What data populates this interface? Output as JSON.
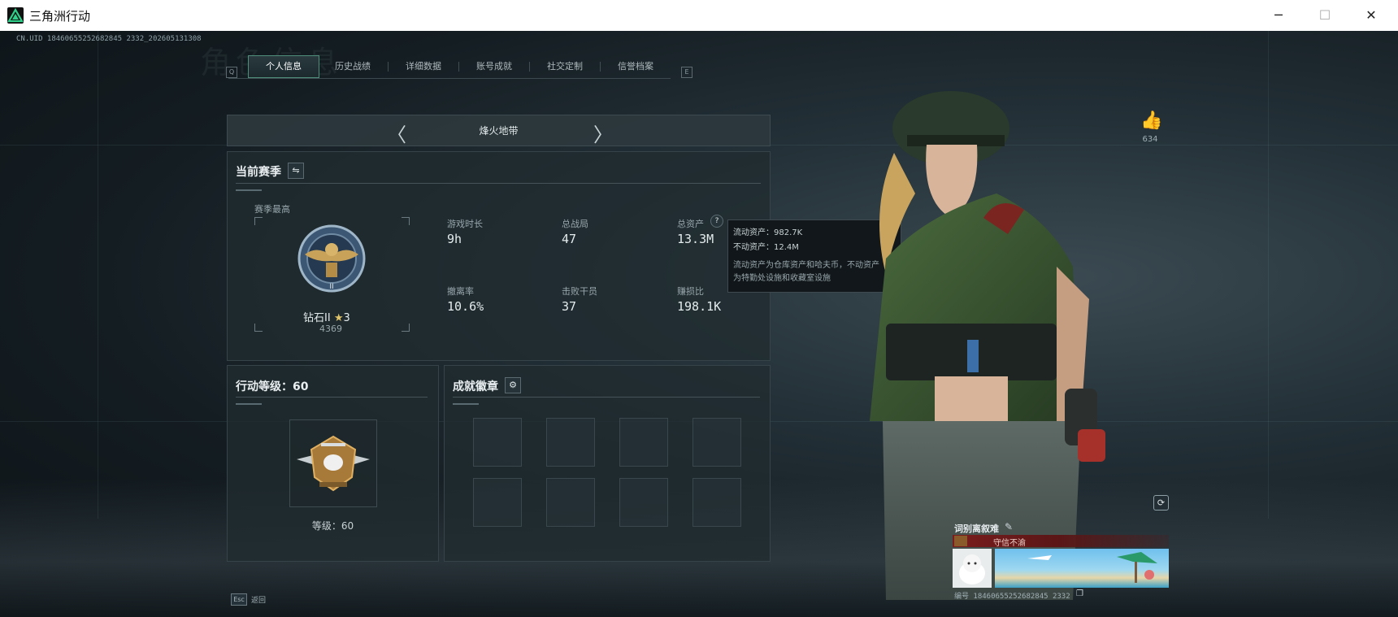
{
  "window": {
    "title": "三角洲行动",
    "minimize": "─",
    "maximize": "☐",
    "close": "✕"
  },
  "header": {
    "uid": "CN.UID 18460655252682845 2332_202605131308",
    "big_title": "角色信息"
  },
  "tabs": [
    {
      "label": "个人信息",
      "active": true
    },
    {
      "label": "历史战绩"
    },
    {
      "label": "详细数据"
    },
    {
      "label": "账号成就"
    },
    {
      "label": "社交定制"
    },
    {
      "label": "信誉档案"
    }
  ],
  "tab_hints": {
    "left": "Q",
    "right": "E"
  },
  "mode": {
    "name": "烽火地带",
    "prev": "〈",
    "next": "〉"
  },
  "season": {
    "title": "当前赛季",
    "switch_icon": "⇋",
    "best_label": "赛季最高",
    "rank_name": "钻石II",
    "rank_stars": "3",
    "rank_points": "4369",
    "stats": [
      {
        "label": "游戏时长",
        "value": "9h"
      },
      {
        "label": "总战局",
        "value": "47"
      },
      {
        "label": "总资产",
        "value": "13.3M"
      },
      {
        "label": "撤离率",
        "value": "10.6%"
      },
      {
        "label": "击败干员",
        "value": "37"
      },
      {
        "label": "赚损比",
        "value": "198.1K"
      }
    ],
    "help_icon": "?"
  },
  "tooltip": {
    "liquid": "流动资产：982.7K",
    "fixed": "不动资产：12.4M",
    "desc_line1": "流动资产为仓库资产和哈夫币，不动资产",
    "desc_line2": "为特勤处设施和收藏室设施"
  },
  "action_level": {
    "title": "行动等级：60",
    "level_label": "等级：60"
  },
  "achievements": {
    "title": "成就徽章",
    "gear_icon": "⚙"
  },
  "profile": {
    "likes": "634",
    "thumb_icon": "👍",
    "refresh_icon": "⟳",
    "name": "词别离叙难",
    "edit_icon": "✎",
    "title_badge": "守信不渝",
    "id_text": "编号 18460655252682845 2332"
  },
  "footer": {
    "esc_key": "Esc",
    "esc_label": "返回"
  },
  "colors": {
    "accent": "#4f8e7a",
    "badge": "#7a1d1d"
  }
}
